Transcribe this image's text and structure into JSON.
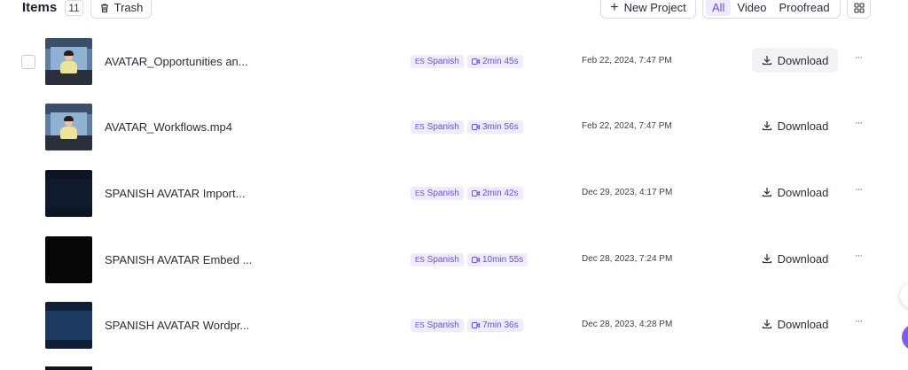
{
  "header": {
    "title": "Items",
    "count": "11",
    "trash_label": "Trash",
    "new_project_label": "New Project",
    "filters": [
      {
        "label": "All",
        "active": true
      },
      {
        "label": "Video",
        "active": false
      },
      {
        "label": "Proofread",
        "active": false
      }
    ]
  },
  "accent_color": "#6a4df5",
  "items": [
    {
      "name": "AVATAR_Opportunities an...",
      "language": "Spanish",
      "language_code": "ES",
      "duration": "2min 45s",
      "date": "Feb 22, 2024, 7:47 PM",
      "download_label": "Download",
      "more": "···",
      "thumbnail": "avatar"
    },
    {
      "name": "AVATAR_Workflows.mp4",
      "language": "Spanish",
      "language_code": "ES",
      "duration": "3min 56s",
      "date": "Feb 22, 2024, 7:47 PM",
      "download_label": "Download",
      "more": "···",
      "thumbnail": "avatar"
    },
    {
      "name": "SPANISH AVATAR Import...",
      "language": "Spanish",
      "language_code": "ES",
      "duration": "2min 42s",
      "date": "Dec 29, 2023, 4:17 PM",
      "download_label": "Download",
      "more": "···",
      "thumbnail": "dark"
    },
    {
      "name": "SPANISH AVATAR Embed ...",
      "language": "Spanish",
      "language_code": "ES",
      "duration": "10min 55s",
      "date": "Dec 28, 2023, 7:24 PM",
      "download_label": "Download",
      "more": "···",
      "thumbnail": "black"
    },
    {
      "name": "SPANISH AVATAR Wordpr...",
      "language": "Spanish",
      "language_code": "ES",
      "duration": "7min 36s",
      "date": "Dec 28, 2023, 4:28 PM",
      "download_label": "Download",
      "more": "···",
      "thumbnail": "blue"
    }
  ]
}
